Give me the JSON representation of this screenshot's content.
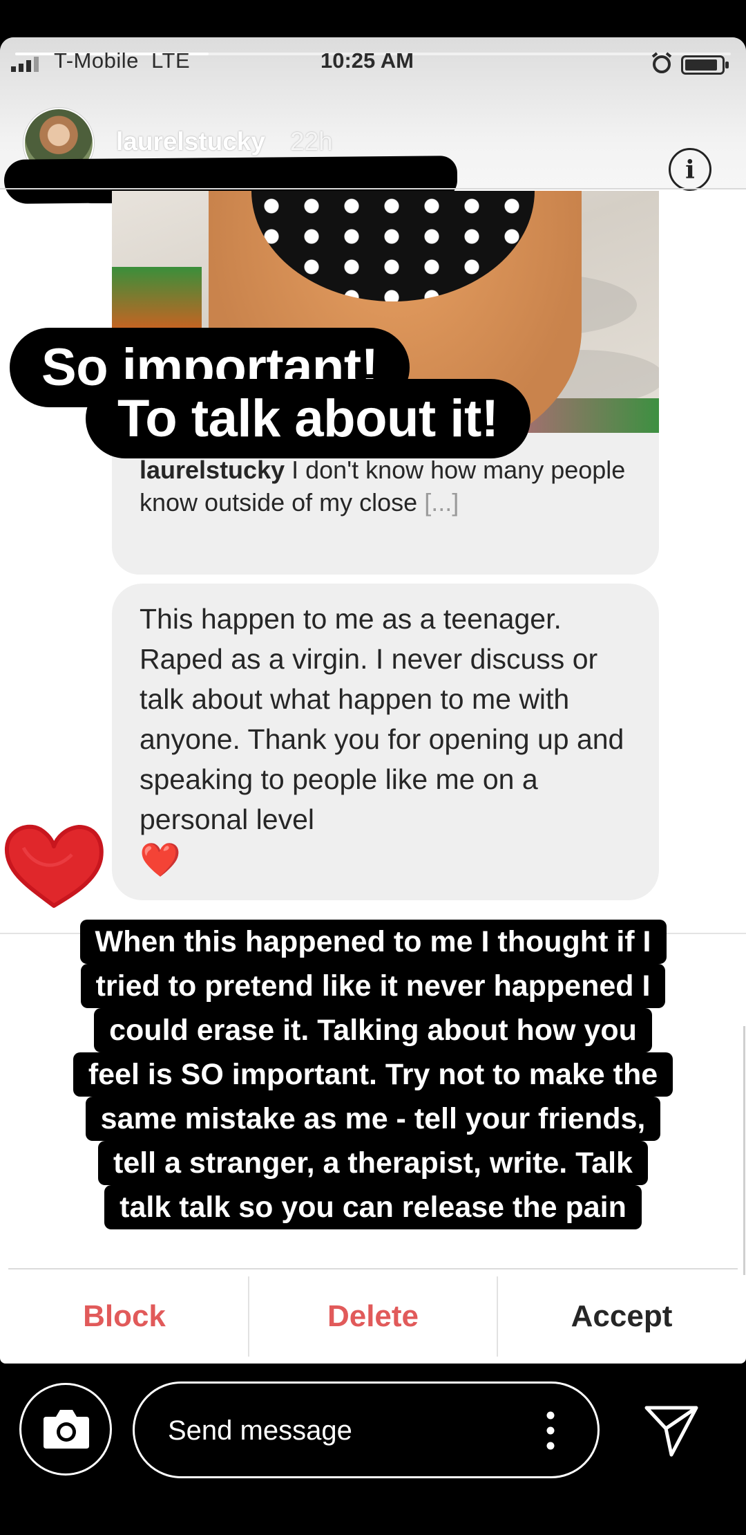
{
  "status_bar": {
    "carrier": "T-Mobile",
    "network": "LTE",
    "time": "10:25 AM"
  },
  "story": {
    "progress": 0.27,
    "username": "laurelstucky",
    "timestamp": "22h"
  },
  "shared_post": {
    "caption_user": "laurelstucky",
    "caption_text": " I don't know how many people know outside of my close ",
    "caption_more": "[...]"
  },
  "message": {
    "text": "This happen to me as a teenager. Raped as a virgin. I never discuss or talk about what happen to me with anyone. Thank you for opening up and speaking to people like me on a personal level",
    "emoji": "❤️"
  },
  "stickers": {
    "headline_line1": "So important!",
    "headline_line2": "To talk about it!",
    "body_lines": [
      "When this happened to me I thought if I",
      "tried to pretend like it never happened I",
      "could erase it. Talking about how you",
      "feel is SO important. Try not to make the",
      "same mistake as me - tell your friends,",
      "tell a stranger, a therapist, write. Talk",
      "talk talk so you can release the pain"
    ]
  },
  "actions": {
    "block": "Block",
    "delete": "Delete",
    "accept": "Accept"
  },
  "reply": {
    "placeholder": "Send message"
  },
  "colors": {
    "destructive": "#e15a5a",
    "heart": "#e0272b"
  }
}
